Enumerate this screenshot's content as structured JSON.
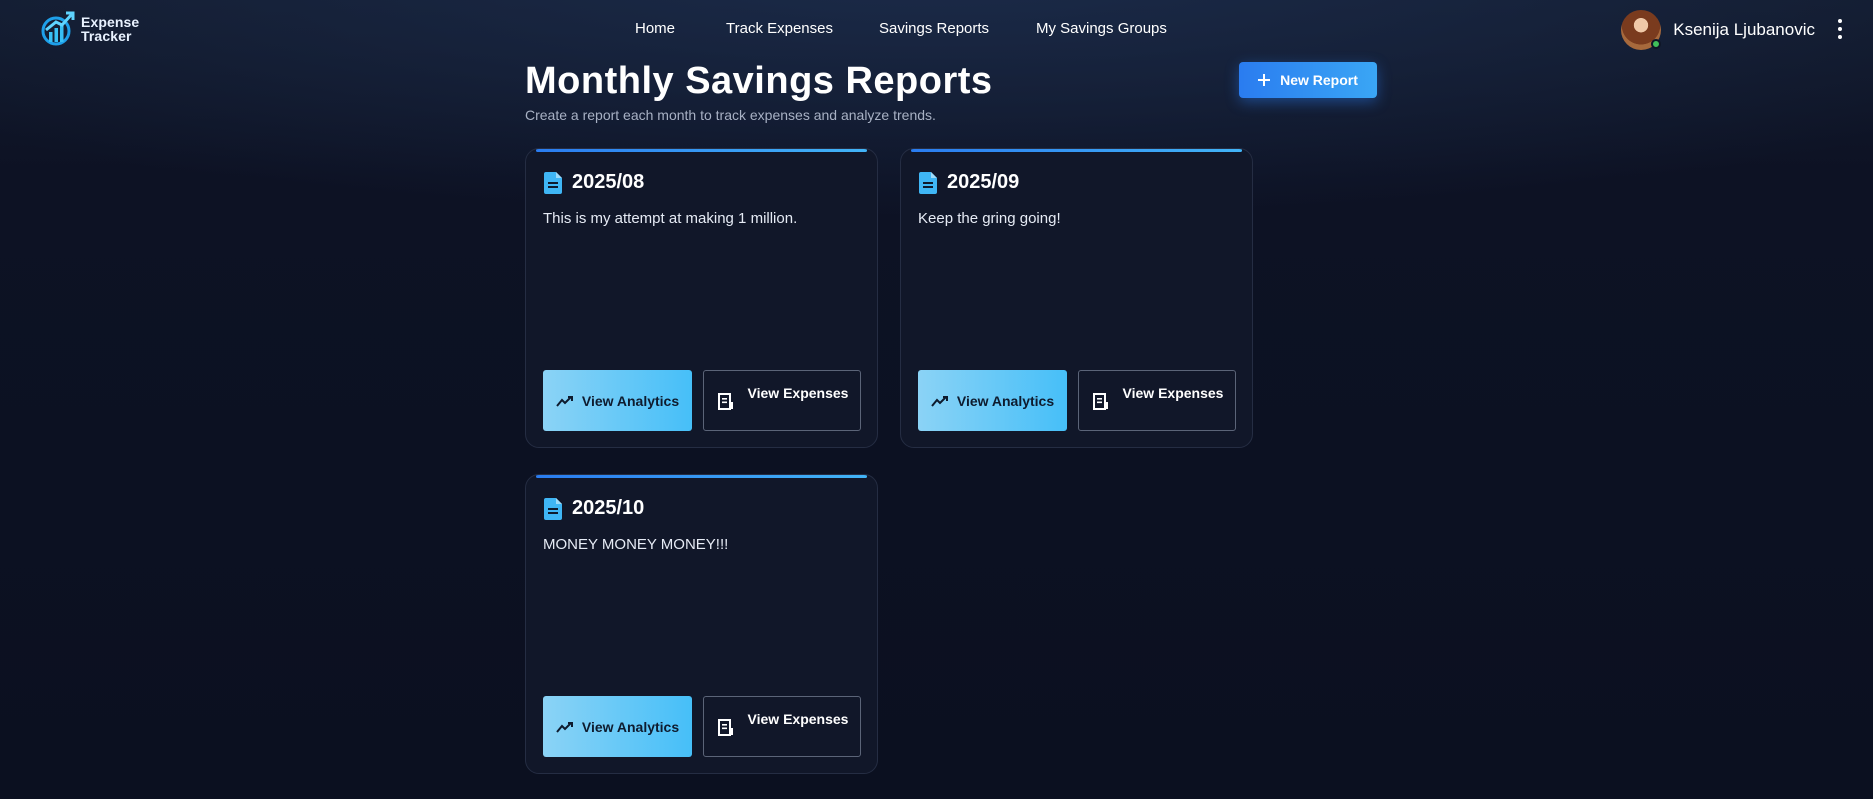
{
  "app": {
    "logo_line1": "Expense",
    "logo_line2": "Tracker"
  },
  "nav": {
    "items": [
      {
        "label": "Home"
      },
      {
        "label": "Track Expenses"
      },
      {
        "label": "Savings Reports"
      },
      {
        "label": "My Savings Groups"
      }
    ]
  },
  "user": {
    "name": "Ksenija Ljubanovic",
    "status": "online"
  },
  "page": {
    "title": "Monthly Savings Reports",
    "subtitle": "Create a report each month to track expenses and analyze trends.",
    "new_report_label": "New Report"
  },
  "reports": [
    {
      "date": "2025/08",
      "description": "This is my attempt at making 1 million.",
      "analytics_label": "View Analytics",
      "expenses_label": "View Expenses"
    },
    {
      "date": "2025/09",
      "description": "Keep the gring going!",
      "analytics_label": "View Analytics",
      "expenses_label": "View Expenses"
    },
    {
      "date": "2025/10",
      "description": "MONEY MONEY MONEY!!!",
      "analytics_label": "View Analytics",
      "expenses_label": "View Expenses"
    }
  ],
  "colors": {
    "accent": "#2a7cf0",
    "analytics_button": "#46bff8",
    "background": "#0b1020",
    "card": "#111729"
  },
  "icons": {
    "logo": "chart-arrow-logo-icon",
    "add": "plus-icon",
    "report": "document-icon",
    "analytics": "trend-chart-icon",
    "expenses": "receipt-icon",
    "menu": "more-vertical-icon"
  }
}
